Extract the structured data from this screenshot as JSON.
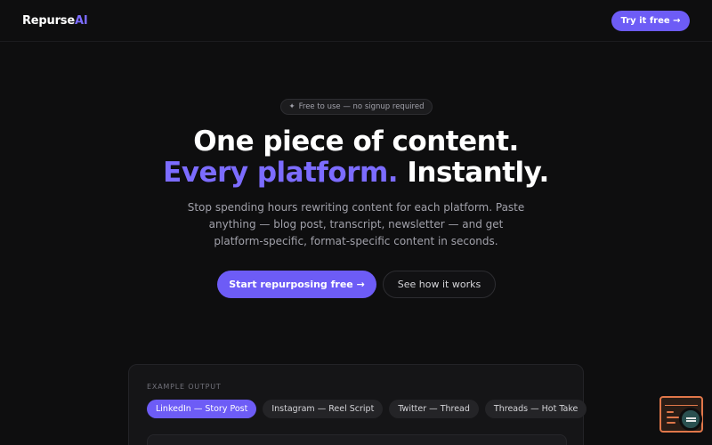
{
  "nav": {
    "logo_main": "Repurse",
    "logo_accent": "AI",
    "cta_label": "Try it free →"
  },
  "hero": {
    "badge_icon": "sparkle-icon",
    "badge_glyph": "✦",
    "badge_text": "Free to use — no signup required",
    "title_line1": "One piece of content.",
    "title_highlight": "Every platform.",
    "title_rest": "Instantly.",
    "subtitle": "Stop spending hours rewriting content for each platform. Paste anything — blog post, transcript, newsletter — and get platform-specific, format-specific content in seconds.",
    "primary_button": "Start repurposing free →",
    "secondary_button": "See how it works"
  },
  "demo": {
    "label": "EXAMPLE OUTPUT",
    "tabs": [
      {
        "label": "LinkedIn — Story Post",
        "active": true
      },
      {
        "label": "Instagram — Reel Script",
        "active": false
      },
      {
        "label": "Twitter — Thread",
        "active": false
      },
      {
        "label": "Threads — Hot Take",
        "active": false
      }
    ]
  },
  "widget": {
    "icon": "code-terminal-icon",
    "search_icon": "search-icon"
  },
  "colors": {
    "background": "#0e0e0f",
    "accent": "#6d5cf6",
    "accent_text": "#7c6cff",
    "muted_text": "#a1a1aa"
  }
}
